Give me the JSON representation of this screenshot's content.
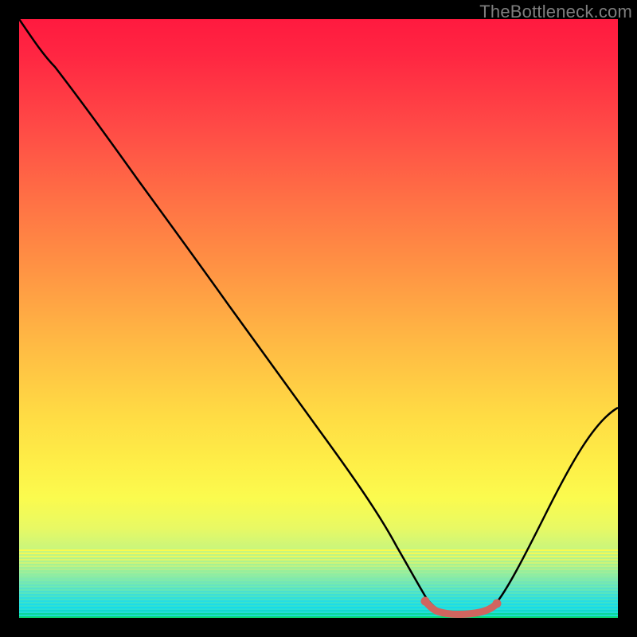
{
  "watermark": "TheBottleneck.com",
  "chart_data": {
    "type": "line",
    "title": "",
    "xlabel": "",
    "ylabel": "",
    "xlim": [
      0,
      100
    ],
    "ylim": [
      0,
      100
    ],
    "x": [
      0,
      2,
      6,
      10,
      15,
      20,
      25,
      30,
      35,
      40,
      45,
      50,
      55,
      60,
      63,
      66,
      68,
      70,
      72,
      74,
      76,
      78,
      80,
      84,
      88,
      92,
      96,
      100
    ],
    "values": [
      100,
      97,
      92,
      86,
      79,
      72,
      65,
      58,
      51,
      44,
      37,
      30,
      23,
      15,
      9,
      4.5,
      2.5,
      1.2,
      0.6,
      0.4,
      0.4,
      0.6,
      1.5,
      5,
      11,
      18,
      26,
      35
    ],
    "min_region": {
      "x_start": 68,
      "x_end": 80,
      "y": 0.5
    },
    "highlight_color": "#d1655f",
    "background": "gradient_red_to_cyan",
    "series_name": "bottleneck_curve"
  }
}
